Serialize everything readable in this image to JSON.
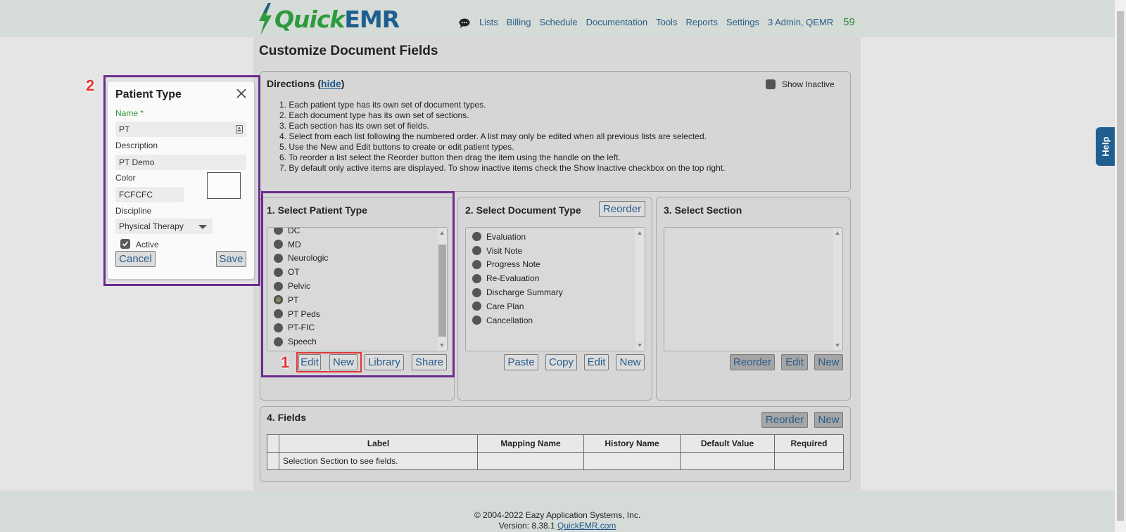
{
  "header": {
    "logo_quick": "Quick",
    "logo_emr": "EMR",
    "nav": [
      "Lists",
      "Billing",
      "Schedule",
      "Documentation",
      "Tools",
      "Reports",
      "Settings",
      "3 Admin, QEMR"
    ],
    "count": "59"
  },
  "page_title": "Customize Document Fields",
  "directions": {
    "title": "Directions (",
    "hide": "hide",
    "title_close": ")",
    "show_inactive": "Show Inactive",
    "items": [
      "1. Each patient type has its own set of document types.",
      "2. Each document type has its own set of sections.",
      "3. Each section has its own set of fields.",
      "4. Select from each list following the numbered order. A list may only be edited when all previous lists are selected.",
      "5. Use the New and Edit buttons to create or edit patient types.",
      "6. To reorder a list select the Reorder button then drag the item using the handle on the left.",
      "7. By default only active items are displayed. To show inactive items check the Show Inactive checkbox on the top right."
    ]
  },
  "patient_type": {
    "title": "1. Select Patient Type",
    "items": [
      "DC",
      "MD",
      "Neurologic",
      "OT",
      "Pelvic",
      "PT",
      "PT Peds",
      "PT-FIC",
      "Speech"
    ],
    "selected": "PT",
    "buttons": {
      "edit": "Edit",
      "new": "New",
      "library": "Library",
      "share": "Share"
    }
  },
  "document_type": {
    "title": "2. Select Document Type",
    "reorder": "Reorder",
    "items": [
      "Evaluation",
      "Visit Note",
      "Progress Note",
      "Re-Evaluation",
      "Discharge Summary",
      "Care Plan",
      "Cancellation"
    ],
    "buttons": {
      "paste": "Paste",
      "copy": "Copy",
      "edit": "Edit",
      "new": "New"
    }
  },
  "section": {
    "title": "3. Select Section",
    "buttons": {
      "reorder": "Reorder",
      "edit": "Edit",
      "new": "New"
    }
  },
  "fields": {
    "title": "4. Fields",
    "reorder": "Reorder",
    "new": "New",
    "columns": [
      "",
      "Label",
      "Mapping Name",
      "History Name",
      "Default Value",
      "Required"
    ],
    "empty_message": "Selection Section to see fields."
  },
  "dialog": {
    "title": "Patient Type",
    "name_label": "Name *",
    "name_value": "PT",
    "description_label": "Description",
    "description_value": "PT Demo",
    "color_label": "Color",
    "color_value": "FCFCFC",
    "discipline_label": "Discipline",
    "discipline_value": "Physical Therapy",
    "active_label": "Active",
    "active_checked": true,
    "cancel": "Cancel",
    "save": "Save"
  },
  "annotations": {
    "marker1": "1",
    "marker2": "2"
  },
  "help": "Help",
  "footer": {
    "copyright": "© 2004-2022 Eazy Application Systems, Inc.",
    "version": "Version: 8.38.1 ",
    "link": "QuickEMR.com"
  },
  "colors": {
    "brand_green": "#2e9a3e",
    "brand_blue": "#1e5f8f",
    "link": "#2a5d8a",
    "highlight_purple": "#6a2c8f",
    "highlight_red": "#e0373a"
  }
}
